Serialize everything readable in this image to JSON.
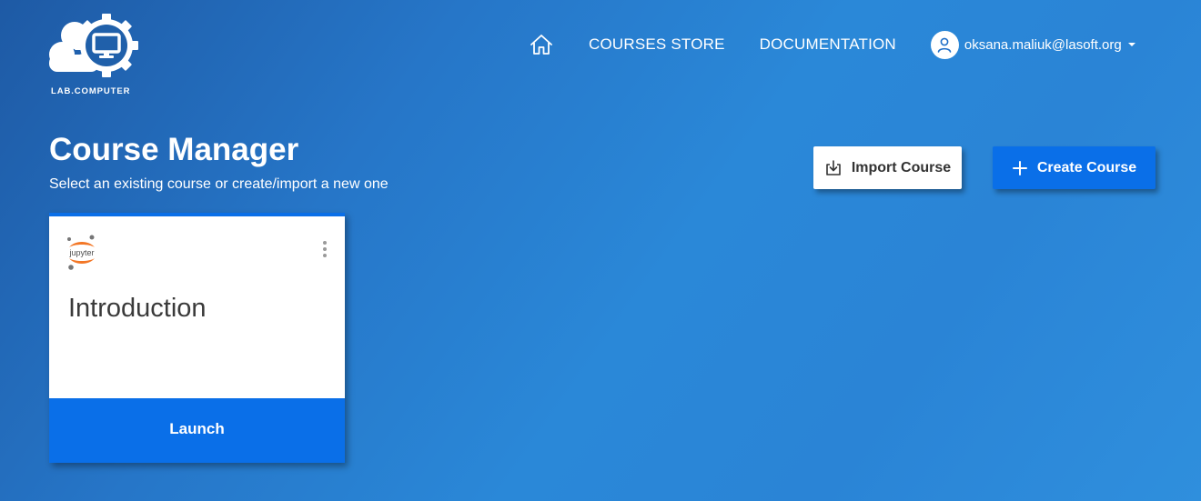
{
  "brand": {
    "name": "LAB.COMPUTER",
    "logo_icon": "cloud-gear-monitor-icon"
  },
  "nav": {
    "home_icon": "home-icon",
    "links": [
      {
        "label": "COURSES STORE"
      },
      {
        "label": "DOCUMENTATION"
      }
    ],
    "user": {
      "email": "oksana.maliuk@lasoft.org",
      "avatar_icon": "user-icon",
      "dropdown_icon": "caret-down-icon"
    }
  },
  "header": {
    "title": "Course Manager",
    "subtitle": "Select an existing course or create/import a new one"
  },
  "actions": {
    "import": {
      "label": "Import Course",
      "icon": "import-icon"
    },
    "create": {
      "label": "Create Course",
      "icon": "plus-icon"
    }
  },
  "courses": [
    {
      "title": "Introduction",
      "platform_logo": "jupyter-icon",
      "platform_text": "jupyter",
      "launch_label": "Launch",
      "menu_icon": "more-vertical-icon"
    }
  ],
  "colors": {
    "primary": "#0a6fe8",
    "background_start": "#1e5aa5",
    "background_end": "#2f8fdd",
    "jupyter_orange": "#f37726"
  }
}
